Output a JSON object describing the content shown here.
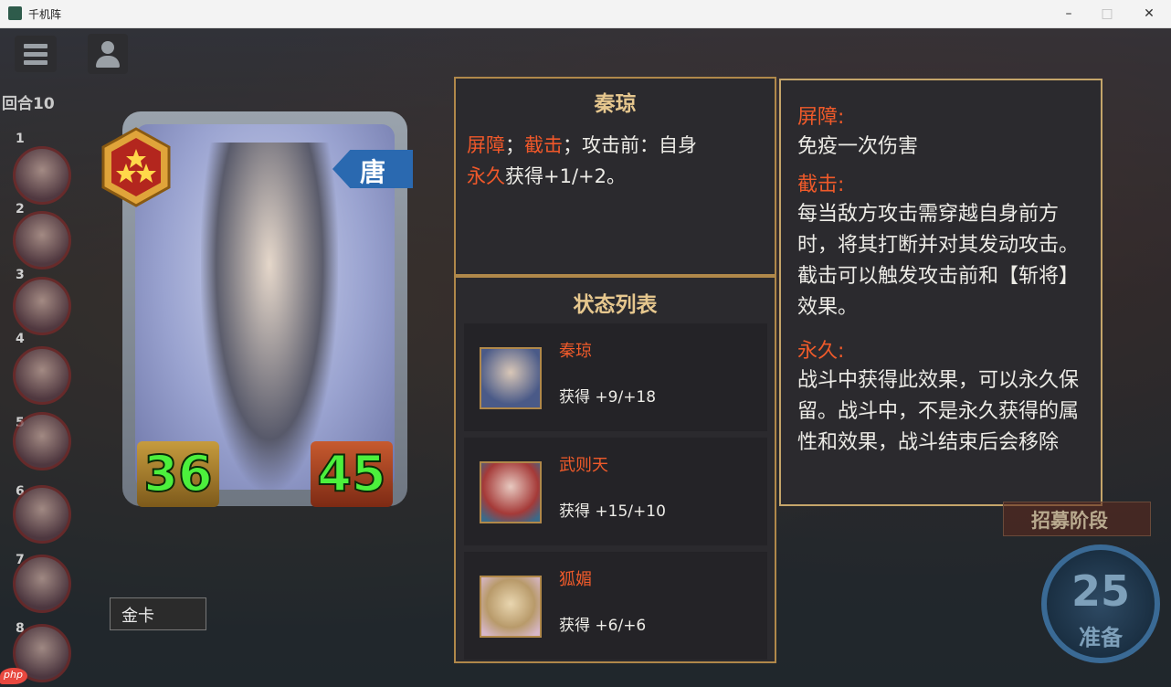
{
  "window": {
    "title": "千机阵"
  },
  "hud": {
    "round": "回合10",
    "side_numbers": [
      "1",
      "2",
      "3",
      "4",
      "5",
      "6",
      "7",
      "8"
    ]
  },
  "card": {
    "faction": "唐",
    "attack": "36",
    "health": "45",
    "stars": 3,
    "label": "金卡"
  },
  "name_panel": {
    "name": "秦琼",
    "skill_kw1": "屏障",
    "sep1": "；",
    "skill_kw2": "截击",
    "skill_part1": "；攻击前：自身",
    "skill_kw3": "永久",
    "skill_part2": "获得+1/+2。"
  },
  "status_panel": {
    "title": "状态列表",
    "items": [
      {
        "name": "秦琼",
        "gain": "获得 +9/+18"
      },
      {
        "name": "武则天",
        "gain": "获得 +15/+10"
      },
      {
        "name": "狐媚",
        "gain": "获得 +6/+6"
      }
    ]
  },
  "description_panel": {
    "h1": "屏障:",
    "t1": "免疫一次伤害",
    "h2": "截击:",
    "t2": "每当敌方攻击需穿越自身前方时，将其打断并对其发动攻击。截击可以触发攻击前和【斩将】效果。",
    "h3": "永久:",
    "t3": "战斗中获得此效果，可以永久保留。战斗中，不是永久获得的属性和效果，战斗结束后会移除"
  },
  "timer": {
    "value": "25",
    "label": "准备"
  },
  "recruit": {
    "label": "招募阶段"
  },
  "watermark": {
    "text": "php"
  },
  "colors": {
    "highlight": "#f0582a",
    "panel_border": "#b0884a",
    "panel_bg": "#2b2a2e",
    "title_gold": "#e6c78e"
  }
}
